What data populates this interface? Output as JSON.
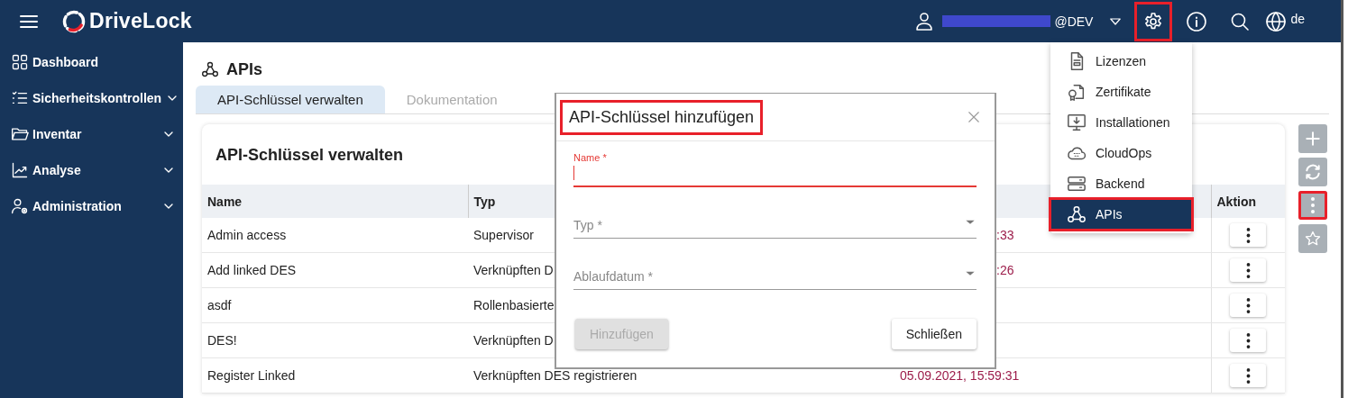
{
  "header": {
    "logo": "DriveLock",
    "user": "@DEV",
    "language": "de",
    "settings_highlighted": true
  },
  "sidebar": {
    "items": [
      {
        "label": "Dashboard",
        "expandable": false
      },
      {
        "label": "Sicherheitskontrollen",
        "expandable": true
      },
      {
        "label": "Inventar",
        "expandable": true
      },
      {
        "label": "Analyse",
        "expandable": true
      },
      {
        "label": "Administration",
        "expandable": true
      }
    ]
  },
  "page": {
    "title": "APIs"
  },
  "tabs": [
    {
      "label": "API-Schlüssel verwalten",
      "selected": true
    },
    {
      "label": "Dokumentation",
      "selected": false
    }
  ],
  "card": {
    "title": "API-Schlüssel verwalten"
  },
  "table": {
    "headers": {
      "name": "Name",
      "typ": "Typ",
      "aktion": "Aktion"
    },
    "rows": [
      {
        "name": "Admin access",
        "typ": "Supervisor",
        "column_3": ":33",
        "under_dialog": true
      },
      {
        "name": "Add linked DES",
        "typ": "Verknüpften D",
        "column_3": ":26",
        "under_dialog": true
      },
      {
        "name": "asdf",
        "typ": "Rollenbasierte"
      },
      {
        "name": "DES!",
        "typ": "Verknüpften D"
      },
      {
        "name": "Register Linked",
        "typ": "Verknüpften DES registrieren",
        "column_3": "05.09.2021, 15:59:31",
        "under_dialog": false
      }
    ]
  },
  "side_buttons": [
    {
      "kind": "add",
      "highlighted": false
    },
    {
      "kind": "refresh",
      "highlighted": false
    },
    {
      "kind": "more",
      "highlighted": true
    },
    {
      "kind": "favorite",
      "highlighted": false
    }
  ],
  "menu": {
    "items": [
      {
        "label": "Lizenzen",
        "kind": "license",
        "selected": false,
        "highlighted": false
      },
      {
        "label": "Zertifikate",
        "kind": "certificate",
        "selected": false,
        "highlighted": false
      },
      {
        "label": "Installationen",
        "kind": "install",
        "selected": false,
        "highlighted": false
      },
      {
        "label": "CloudOps",
        "kind": "cloud",
        "selected": false,
        "highlighted": false
      },
      {
        "label": "Backend",
        "kind": "server",
        "selected": false,
        "highlighted": false
      },
      {
        "label": "APIs",
        "kind": "api",
        "selected": true,
        "highlighted": true
      }
    ]
  },
  "dialog": {
    "title": "API-Schlüssel hinzufügen",
    "title_highlighted": true,
    "fields": [
      {
        "label": "Name *",
        "kind": "text",
        "focused": true
      },
      {
        "label": "Typ *",
        "kind": "select",
        "focused": false
      },
      {
        "label": "Ablaufdatum *",
        "kind": "select",
        "focused": false
      }
    ],
    "buttons": [
      {
        "label": "Hinzufügen",
        "disabled": true
      },
      {
        "label": "Schließen",
        "disabled": false
      }
    ]
  }
}
